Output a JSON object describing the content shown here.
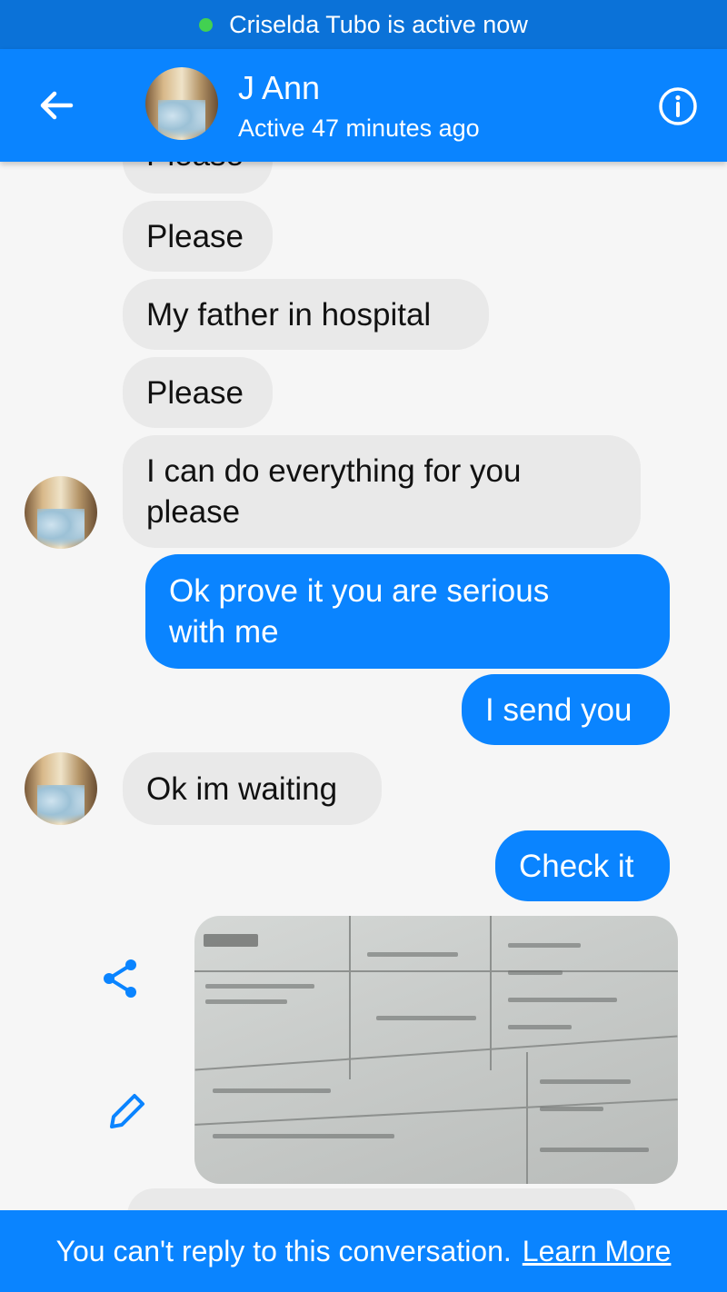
{
  "status_banner": {
    "text": "Criselda Tubo is active now",
    "dot_color": "#42d151"
  },
  "header": {
    "contact_name": "J Ann",
    "presence": "Active 47 minutes ago",
    "back_icon": "arrow-left-icon",
    "info_icon": "info-circle-icon"
  },
  "messages": [
    {
      "from": "contact",
      "text": "Please"
    },
    {
      "from": "contact",
      "text": "Please"
    },
    {
      "from": "contact",
      "text": "My father in hospital"
    },
    {
      "from": "contact",
      "text": "Please"
    },
    {
      "from": "contact",
      "text": "I can do everything for you please"
    },
    {
      "from": "me",
      "text": "Ok prove it you are serious with me"
    },
    {
      "from": "me",
      "text": "I send you"
    },
    {
      "from": "contact",
      "text": "Ok im waiting"
    },
    {
      "from": "me",
      "text": "Check it"
    },
    {
      "from": "me",
      "type": "photo",
      "description_icon": "document-photo"
    }
  ],
  "photo_actions": {
    "share_icon": "share-icon",
    "edit_icon": "pencil-icon"
  },
  "footer": {
    "text": "You can't reply to this conversation.",
    "link": "Learn More"
  },
  "colors": {
    "accent": "#0a84ff",
    "status_bar": "#0b72d8",
    "incoming_bubble": "#e9e9e9",
    "background": "#f6f6f6"
  }
}
